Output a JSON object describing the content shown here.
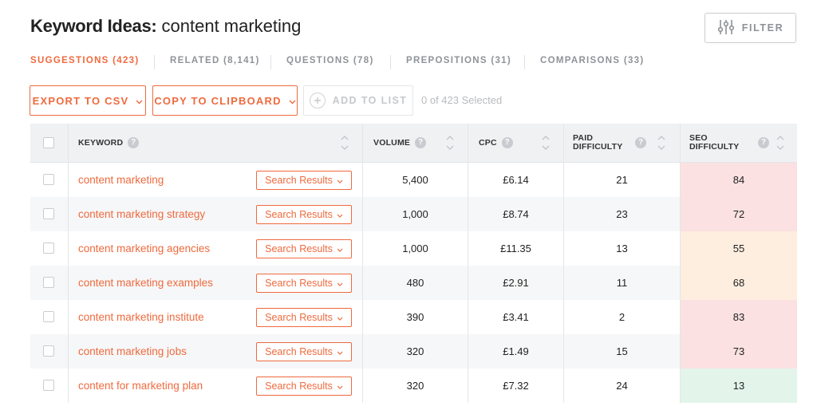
{
  "header": {
    "title_bold": "Keyword Ideas:",
    "title_rest": " content marketing",
    "filter_label": "FILTER"
  },
  "tabs": [
    {
      "label": "SUGGESTIONS (423)",
      "active": true
    },
    {
      "label": "RELATED (8,141)",
      "active": false
    },
    {
      "label": "QUESTIONS (78)",
      "active": false
    },
    {
      "label": "PREPOSITIONS (31)",
      "active": false
    },
    {
      "label": "COMPARISONS (33)",
      "active": false
    }
  ],
  "toolbar": {
    "export_label": "EXPORT TO CSV",
    "copy_label": "COPY TO CLIPBOARD",
    "add_label": "ADD TO LIST",
    "selected_text": "0 of 423 Selected"
  },
  "table": {
    "headers": {
      "keyword": "KEYWORD",
      "volume": "VOLUME",
      "cpc": "CPC",
      "paid_1": "PAID",
      "paid_2": "DIFFICULTY",
      "seo_1": "SEO",
      "seo_2": "DIFFICULTY"
    },
    "help_glyph": "?",
    "rows": [
      {
        "keyword": "content marketing",
        "action": "Search Results",
        "volume": "5,400",
        "cpc": "£6.14",
        "paid": "21",
        "seo": "84",
        "seo_color": "#fbe1e2"
      },
      {
        "keyword": "content marketing strategy",
        "action": "Search Results",
        "volume": "1,000",
        "cpc": "£8.74",
        "paid": "23",
        "seo": "72",
        "seo_color": "#fbe1e2"
      },
      {
        "keyword": "content marketing agencies",
        "action": "Search Results",
        "volume": "1,000",
        "cpc": "£11.35",
        "paid": "13",
        "seo": "55",
        "seo_color": "#fdeee0"
      },
      {
        "keyword": "content marketing examples",
        "action": "Search Results",
        "volume": "480",
        "cpc": "£2.91",
        "paid": "11",
        "seo": "68",
        "seo_color": "#fdeee0"
      },
      {
        "keyword": "content marketing institute",
        "action": "Search Results",
        "volume": "390",
        "cpc": "£3.41",
        "paid": "2",
        "seo": "83",
        "seo_color": "#fbe1e2"
      },
      {
        "keyword": "content marketing jobs",
        "action": "Search Results",
        "volume": "320",
        "cpc": "£1.49",
        "paid": "15",
        "seo": "73",
        "seo_color": "#fbe1e2"
      },
      {
        "keyword": "content for marketing plan",
        "action": "Search Results",
        "volume": "320",
        "cpc": "£7.32",
        "paid": "24",
        "seo": "13",
        "seo_color": "#e3f5ea"
      }
    ]
  },
  "colors": {
    "accent": "#ef6a3e",
    "seo_high": "#fbe1e2",
    "seo_mid": "#fdeee0",
    "seo_low": "#e3f5ea"
  },
  "icons": {
    "filter": "sliders-icon",
    "dropdown": "chevron-down-icon",
    "add": "plus-circle-icon",
    "help": "question-circle-icon",
    "sort": "sort-arrows-icon"
  }
}
